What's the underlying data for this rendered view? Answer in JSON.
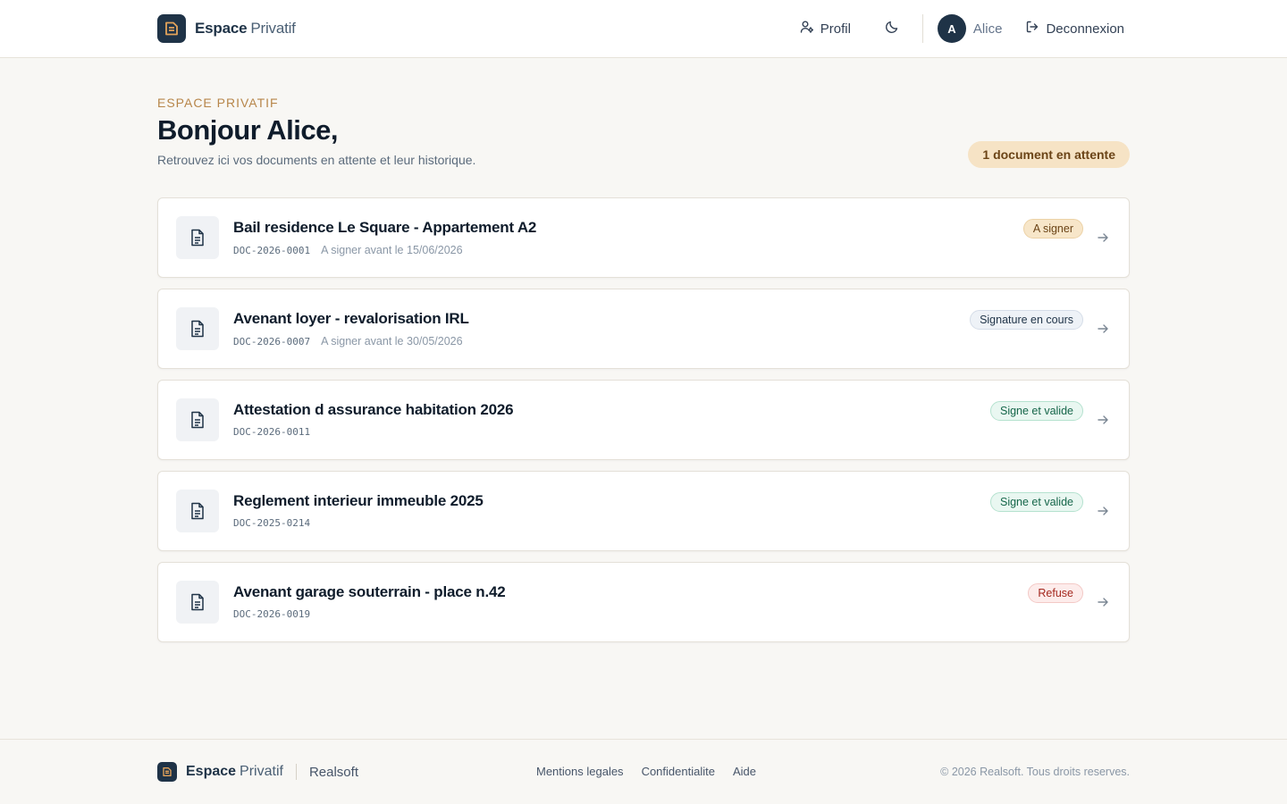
{
  "header": {
    "brand_strong": "Espace",
    "brand_light": "Privatif",
    "profile_label": "Profil",
    "avatar_initial": "A",
    "user_name": "Alice",
    "logout_label": "Deconnexion"
  },
  "hero": {
    "eyebrow": "ESPACE PRIVATIF",
    "greeting": "Bonjour Alice,",
    "subtitle": "Retrouvez ici vos documents en attente et leur historique.",
    "pending_badge": "1 document en attente"
  },
  "documents": [
    {
      "title": "Bail residence Le Square - Appartement A2",
      "reference": "DOC-2026-0001",
      "deadline": "A signer avant le 15/06/2026",
      "status": "A signer",
      "status_kind": "tosign"
    },
    {
      "title": "Avenant loyer - revalorisation IRL",
      "reference": "DOC-2026-0007",
      "deadline": "A signer avant le 30/05/2026",
      "status": "Signature en cours",
      "status_kind": "progress"
    },
    {
      "title": "Attestation d assurance habitation 2026",
      "reference": "DOC-2026-0011",
      "deadline": "",
      "status": "Signe et valide",
      "status_kind": "valid"
    },
    {
      "title": "Reglement interieur immeuble 2025",
      "reference": "DOC-2025-0214",
      "deadline": "",
      "status": "Signe et valide",
      "status_kind": "valid"
    },
    {
      "title": "Avenant garage souterrain - place n.42",
      "reference": "DOC-2026-0019",
      "deadline": "",
      "status": "Refuse",
      "status_kind": "refused"
    }
  ],
  "footer": {
    "brand_strong": "Espace",
    "brand_light": "Privatif",
    "company": "Realsoft",
    "links": [
      "Mentions legales",
      "Confidentialite",
      "Aide"
    ],
    "copyright": "© 2026 Realsoft. Tous droits reserves."
  },
  "colors": {
    "navy": "#1f3347",
    "accent": "#b7864a",
    "background": "#f8f7f4"
  },
  "icons": {
    "logo": "document-logo-icon",
    "profile": "user-icon",
    "theme": "moon-icon",
    "logout": "logout-icon",
    "document": "file-text-icon",
    "open": "arrow-right-icon"
  }
}
